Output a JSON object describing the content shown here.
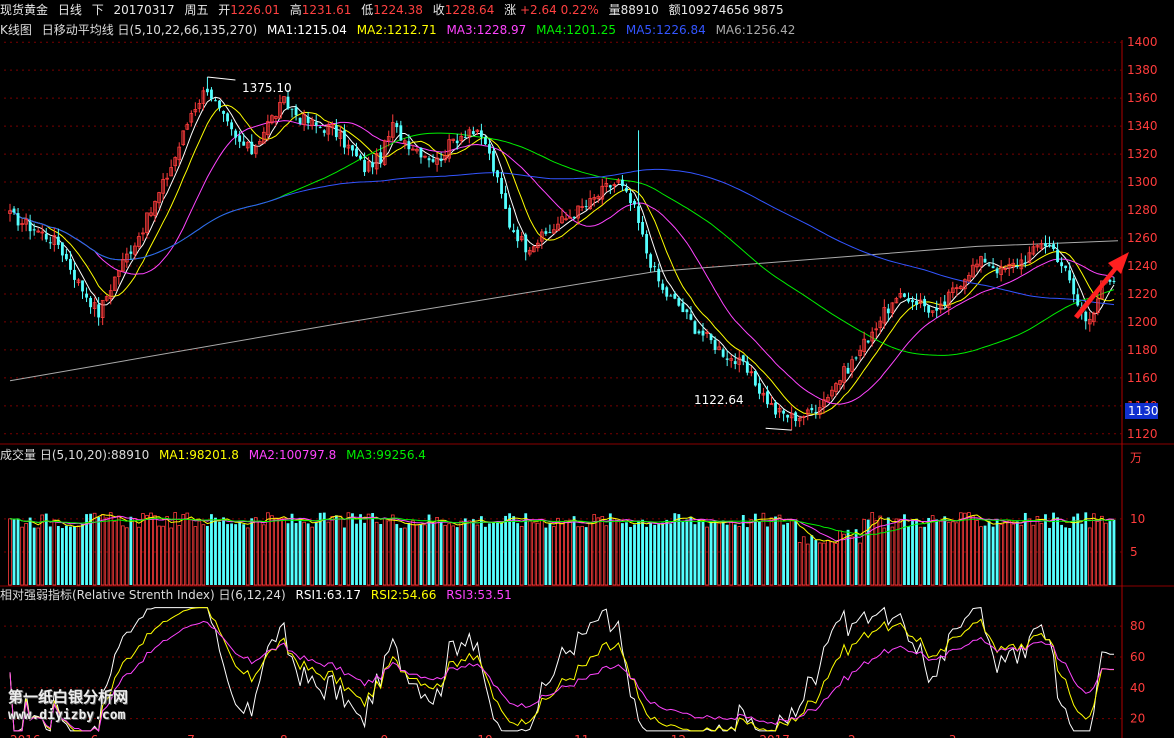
{
  "header": {
    "name": "现货黄金",
    "period": "日线",
    "direction": "下",
    "date": "20170317",
    "weekday": "周五",
    "open_label": "开",
    "open": "1226.01",
    "high_label": "高",
    "high": "1231.61",
    "low_label": "低",
    "low": "1224.38",
    "close_label": "收",
    "close": "1228.64",
    "change_label": "涨",
    "change": "+2.64",
    "change_pct": "0.22%",
    "volume_label": "量",
    "volume": "88910",
    "amount_label": "额",
    "amount": "109274656 9875"
  },
  "ma_header": {
    "title": "K线图",
    "indicator": "日移动平均线 日(5,10,22,66,135,270)",
    "items": [
      {
        "label": "MA1:1215.04",
        "color": "#ffffff"
      },
      {
        "label": "MA2:1212.71",
        "color": "#ffff00"
      },
      {
        "label": "MA3:1228.97",
        "color": "#ff44ff"
      },
      {
        "label": "MA4:1201.25",
        "color": "#00ee00"
      },
      {
        "label": "MA5:1226.84",
        "color": "#3355ff"
      },
      {
        "label": "MA6:1256.42",
        "color": "#aaaaaa"
      }
    ]
  },
  "vol_header": {
    "title": "成交量 日(5,10,20)",
    "value": ":88910",
    "items": [
      {
        "label": "MA1:98201.8",
        "color": "#ffff00"
      },
      {
        "label": "MA2:100797.8",
        "color": "#ff44ff"
      },
      {
        "label": "MA3:99256.4",
        "color": "#00ee00"
      }
    ],
    "unit": "万"
  },
  "rsi_header": {
    "title": "相对强弱指标(Relative Strenth Index) 日(6,12,24)",
    "items": [
      {
        "label": "RSI1:63.17",
        "color": "#ffffff"
      },
      {
        "label": "RSI2:54.66",
        "color": "#ffff00"
      },
      {
        "label": "RSI3:53.51",
        "color": "#ff44ff"
      }
    ]
  },
  "annotations": {
    "high_mark": "1375.10",
    "low_mark": "1122.64",
    "price_tag": "1130"
  },
  "watermark": {
    "line1": "第一纸白银分析网",
    "line2": "www.diyizby.com"
  },
  "chart_data": [
    {
      "type": "candlestick",
      "title": "K线图",
      "y_ticks": [
        1120,
        1140,
        1160,
        1180,
        1200,
        1220,
        1240,
        1260,
        1280,
        1300,
        1320,
        1340,
        1360,
        1380,
        1400
      ],
      "ylim": [
        1112,
        1403
      ],
      "grid": true,
      "candle_colors": {
        "up": "#ff3c3c",
        "down": "#54ffff"
      },
      "series_names": [
        "MA1",
        "MA2",
        "MA3",
        "MA4",
        "MA5",
        "MA6"
      ],
      "key_points": [
        [
          0,
          1276
        ],
        [
          7,
          1265
        ],
        [
          12,
          1256
        ],
        [
          17,
          1228
        ],
        [
          22,
          1206
        ],
        [
          27,
          1238
        ],
        [
          32,
          1262
        ],
        [
          36,
          1285
        ],
        [
          41,
          1318
        ],
        [
          45,
          1350
        ],
        [
          49,
          1368
        ],
        [
          52,
          1350
        ],
        [
          56,
          1330
        ],
        [
          60,
          1322
        ],
        [
          64,
          1342
        ],
        [
          68,
          1357
        ],
        [
          72,
          1346
        ],
        [
          76,
          1340
        ],
        [
          80,
          1338
        ],
        [
          84,
          1325
        ],
        [
          88,
          1310
        ],
        [
          92,
          1318
        ],
        [
          95,
          1340
        ],
        [
          98,
          1330
        ],
        [
          102,
          1322
        ],
        [
          106,
          1315
        ],
        [
          110,
          1330
        ],
        [
          114,
          1338
        ],
        [
          118,
          1328
        ],
        [
          121,
          1300
        ],
        [
          124,
          1270
        ],
        [
          128,
          1254
        ],
        [
          132,
          1260
        ],
        [
          136,
          1270
        ],
        [
          140,
          1278
        ],
        [
          144,
          1285
        ],
        [
          148,
          1296
        ],
        [
          151,
          1300
        ],
        [
          155,
          1280
        ],
        [
          158,
          1250
        ],
        [
          162,
          1222
        ],
        [
          166,
          1212
        ],
        [
          170,
          1196
        ],
        [
          174,
          1186
        ],
        [
          178,
          1176
        ],
        [
          182,
          1168
        ],
        [
          186,
          1152
        ],
        [
          190,
          1136
        ],
        [
          194,
          1132
        ],
        [
          198,
          1134
        ],
        [
          202,
          1145
        ],
        [
          206,
          1160
        ],
        [
          210,
          1175
        ],
        [
          214,
          1194
        ],
        [
          218,
          1210
        ],
        [
          222,
          1218
        ],
        [
          226,
          1214
        ],
        [
          230,
          1205
        ],
        [
          234,
          1222
        ],
        [
          238,
          1237
        ],
        [
          242,
          1245
        ],
        [
          246,
          1236
        ],
        [
          250,
          1242
        ],
        [
          254,
          1250
        ],
        [
          256,
          1258
        ],
        [
          259,
          1252
        ],
        [
          262,
          1236
        ],
        [
          265,
          1212
        ],
        [
          267,
          1202
        ],
        [
          269,
          1210
        ],
        [
          271,
          1226
        ],
        [
          273,
          1228.64
        ]
      ],
      "ma_periods": [
        5,
        10,
        22,
        66,
        135,
        270
      ],
      "ma6_points": [
        [
          0,
          1158
        ],
        [
          80,
          1198
        ],
        [
          160,
          1236
        ],
        [
          240,
          1254
        ],
        [
          275,
          1258
        ]
      ]
    },
    {
      "type": "bar",
      "title": "成交量",
      "y_ticks": [
        5,
        10
      ],
      "ylim": [
        0,
        18
      ],
      "unit": "万",
      "colors": {
        "up": "#ff3c3c",
        "down": "#54ffff"
      },
      "typical_value": 9.8
    },
    {
      "type": "line",
      "title": "RSI",
      "y_ticks": [
        20,
        40,
        60,
        80
      ],
      "ylim": [
        10,
        95
      ],
      "series": [
        {
          "name": "RSI1",
          "color": "#ffffff",
          "period": 6
        },
        {
          "name": "RSI2",
          "color": "#ffff00",
          "period": 12
        },
        {
          "name": "RSI3",
          "color": "#ff44ff",
          "period": 24
        }
      ]
    }
  ],
  "x_axis_labels": [
    "2016",
    "6",
    "7",
    "8",
    "9",
    "10",
    "11",
    "12",
    "2017",
    "2",
    "3"
  ]
}
